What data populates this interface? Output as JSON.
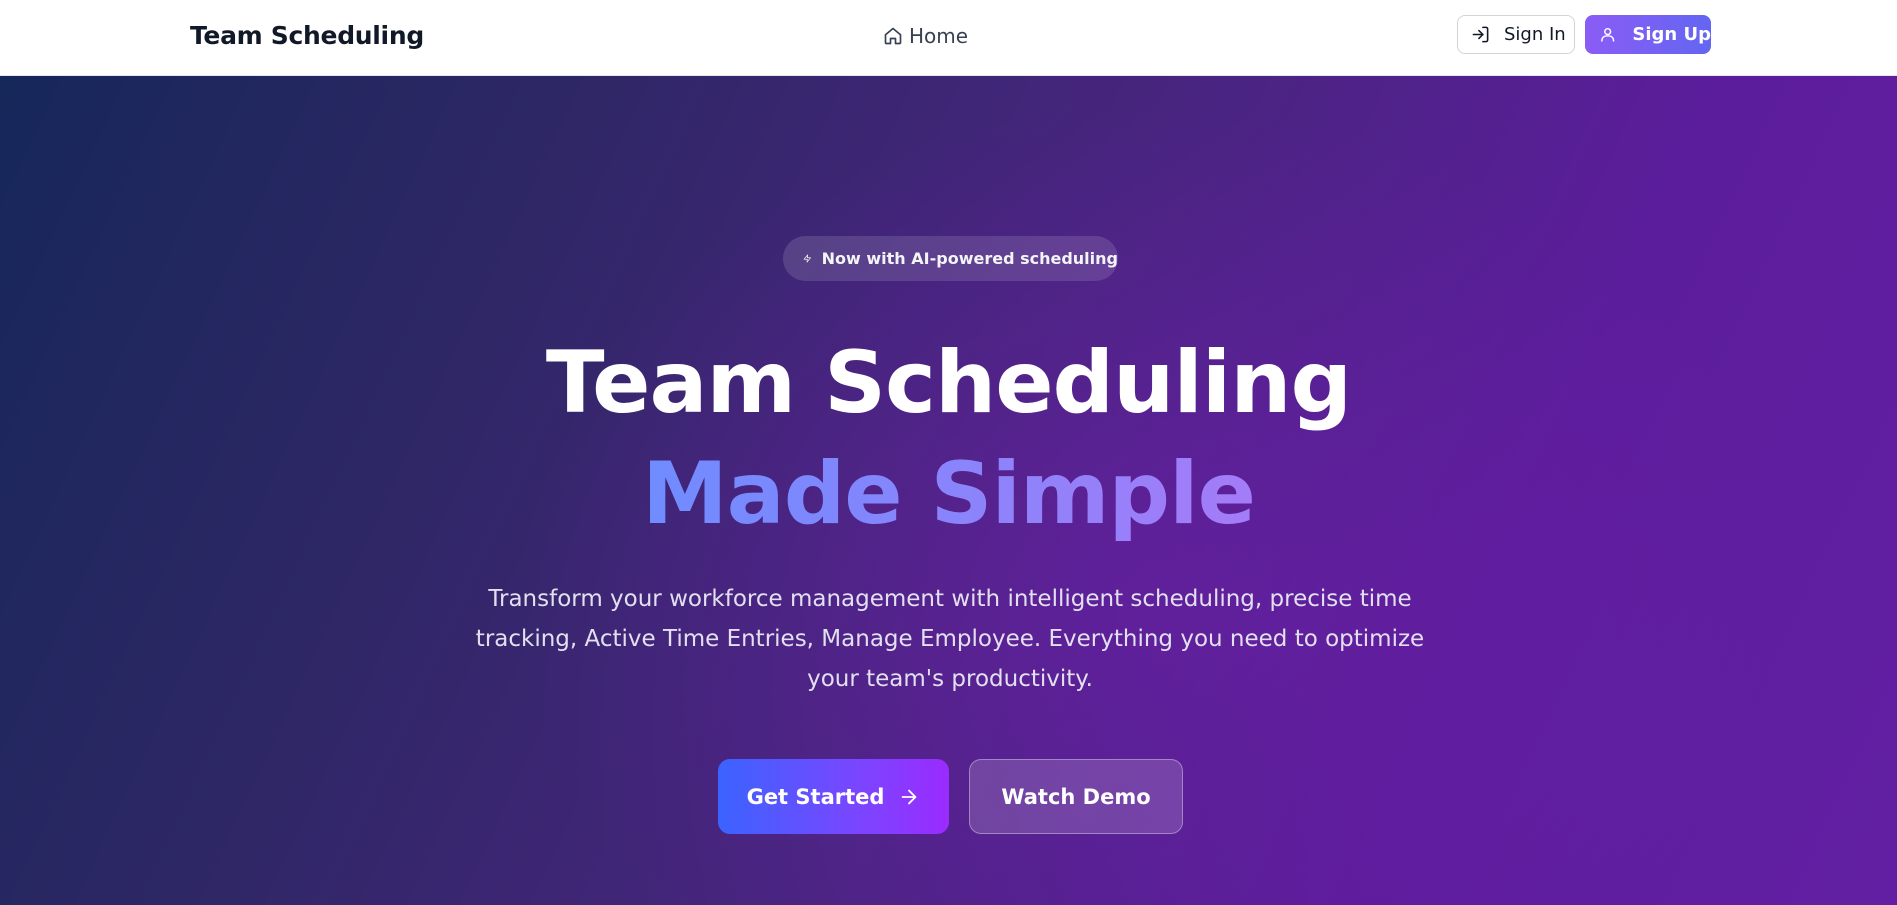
{
  "navbar": {
    "brand": "Team Scheduling",
    "home_label": "Home",
    "signin_label": "Sign In",
    "signup_label": "Sign Up"
  },
  "hero": {
    "badge_text": "Now with AI-powered scheduling",
    "headline_line1": "Team Scheduling",
    "headline_line2": "Made Simple",
    "subtitle": "Transform your workforce management with intelligent scheduling, precise time tracking, Active Time Entries, Manage Employee. Everything you need to optimize your team's productivity.",
    "primary_cta": "Get Started",
    "secondary_cta": "Watch Demo"
  },
  "icons": {
    "home": "home-icon",
    "signin": "log-in-icon",
    "signup": "user-icon",
    "badge": "zap-icon",
    "cta_arrow": "arrow-right-icon"
  },
  "colors": {
    "hero_gradient_start": "#16275a",
    "hero_gradient_end": "#621fa3",
    "signup_gradient_start": "#8b5cf6",
    "signup_gradient_end": "#6366f1",
    "accent_text_start": "#6f8cff",
    "accent_text_end": "#a47cf8",
    "cta_gradient_start": "#3b63ff",
    "cta_gradient_end": "#9a2bff"
  }
}
